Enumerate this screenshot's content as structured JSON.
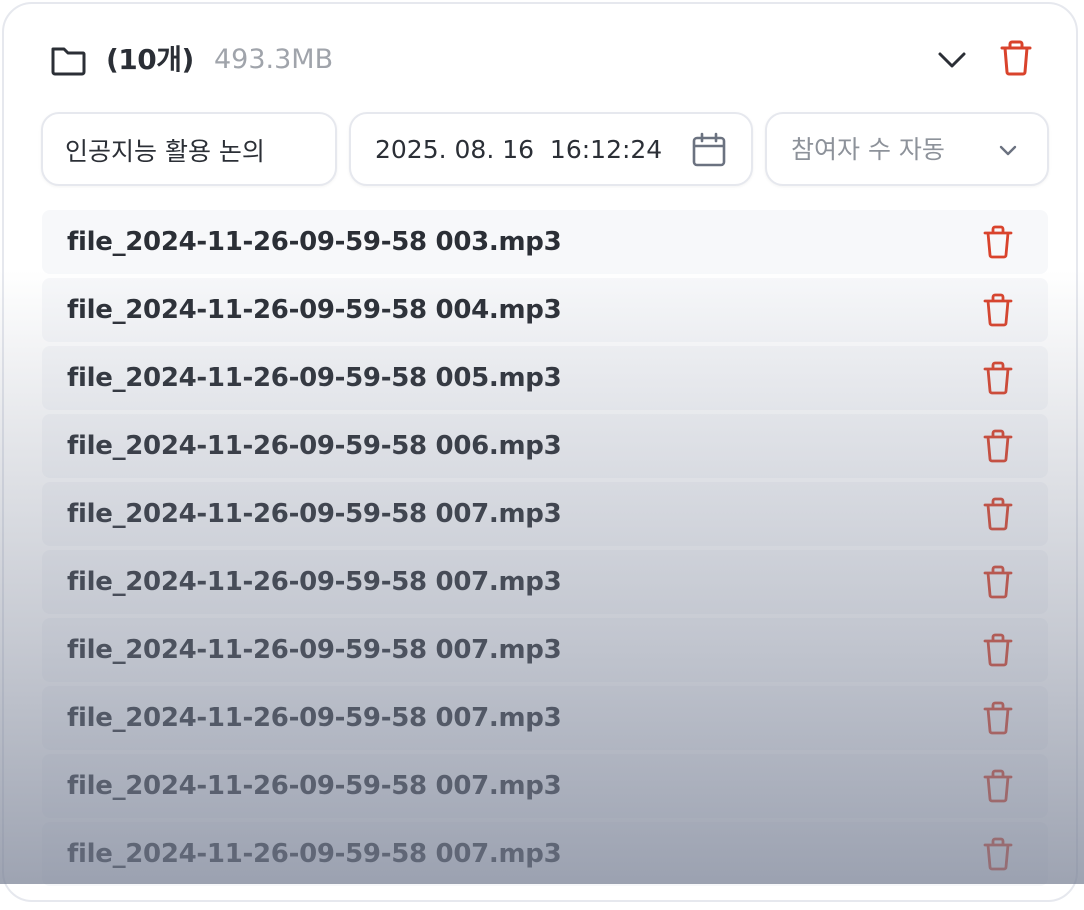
{
  "header": {
    "count_label": "(10개)",
    "size_label": "493.3MB"
  },
  "form": {
    "title_value": "인공지능 활용 논의",
    "date_value": "2025. 08. 16  16:12:24",
    "participants_value": "참여자 수 자동"
  },
  "files": [
    {
      "name": "file_2024-11-26-09-59-58 003.mp3"
    },
    {
      "name": "file_2024-11-26-09-59-58 004.mp3"
    },
    {
      "name": "file_2024-11-26-09-59-58 005.mp3"
    },
    {
      "name": "file_2024-11-26-09-59-58 006.mp3"
    },
    {
      "name": "file_2024-11-26-09-59-58 007.mp3"
    },
    {
      "name": "file_2024-11-26-09-59-58 007.mp3"
    },
    {
      "name": "file_2024-11-26-09-59-58 007.mp3"
    },
    {
      "name": "file_2024-11-26-09-59-58 007.mp3"
    },
    {
      "name": "file_2024-11-26-09-59-58 007.mp3"
    },
    {
      "name": "file_2024-11-26-09-59-58 007.mp3"
    }
  ],
  "icons": {
    "folder": "folder-icon",
    "collapse": "chevron-down-icon",
    "delete": "trash-icon",
    "calendar": "calendar-icon",
    "select": "chevron-down-icon"
  },
  "colors": {
    "delete": "#d9432c",
    "text": "#2b2f36",
    "muted": "#a0a4ab",
    "border": "#e6e8ee",
    "row_bg": "#f7f8fa"
  }
}
